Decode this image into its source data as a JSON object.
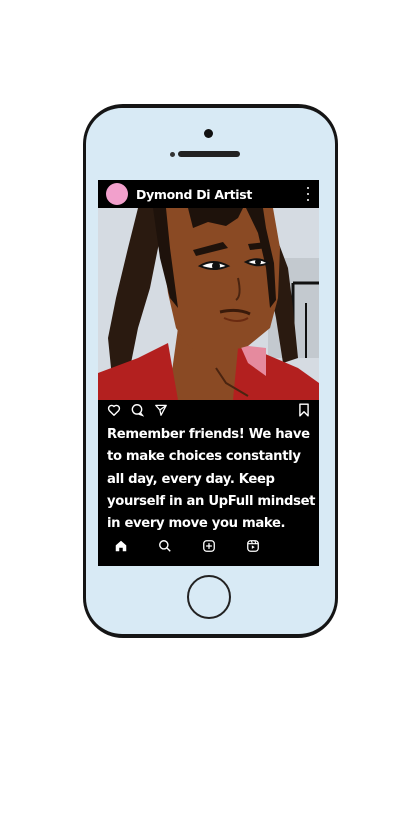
{
  "post": {
    "username": "Dymond Di Artist",
    "caption": "Remember friends!  We have to make choices constantly all day, every day.  Keep yourself in an UpFull mindset in every move you make."
  },
  "icons": {
    "header": [
      "avatar",
      "more-vertical-icon"
    ],
    "actions": [
      "heart-icon",
      "comment-icon",
      "share-icon",
      "bookmark-icon"
    ],
    "bottom_nav": [
      "home-icon",
      "search-icon",
      "add-post-icon",
      "reels-icon"
    ]
  },
  "colors": {
    "avatar": "#f2a0cc",
    "screen_bg": "#000000",
    "phone_bezel": "#d8eaf5",
    "phone_frame": "#151515"
  }
}
